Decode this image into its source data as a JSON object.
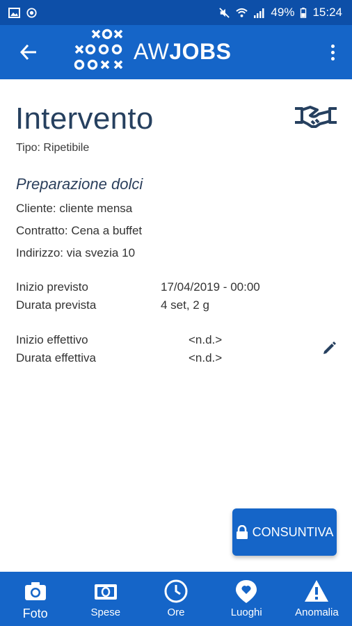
{
  "status_bar": {
    "battery": "49%",
    "time": "15:24"
  },
  "app_bar": {
    "brand_light": "AW",
    "brand_bold": "JOBS"
  },
  "page": {
    "title": "Intervento",
    "tipo": "Tipo: Ripetibile",
    "job_name": "Preparazione dolci",
    "cliente": "Cliente: cliente mensa",
    "contratto": "Contratto: Cena a buffet",
    "indirizzo": "Indirizzo: via svezia 10",
    "inizio_previsto_label": "Inizio previsto",
    "inizio_previsto_value": "17/04/2019 - 00:00",
    "durata_prevista_label": "Durata prevista",
    "durata_prevista_value": "4 set, 2 g",
    "inizio_effettivo_label": "Inizio effettivo",
    "inizio_effettivo_value": "<n.d.>",
    "durata_effettiva_label": "Durata effettiva",
    "durata_effettiva_value": "<n.d.>",
    "consuntiva_label": "CONSUNTIVA"
  },
  "bottom_nav": {
    "items": [
      {
        "label": "Foto",
        "icon": "camera-icon"
      },
      {
        "label": "Spese",
        "icon": "money-icon"
      },
      {
        "label": "Ore",
        "icon": "clock-icon"
      },
      {
        "label": "Luoghi",
        "icon": "location-pin-icon"
      },
      {
        "label": "Anomalia",
        "icon": "warning-icon"
      }
    ]
  },
  "colors": {
    "primary": "#1565c8",
    "status_bar": "#0d4fa8",
    "title_text": "#26405f"
  }
}
